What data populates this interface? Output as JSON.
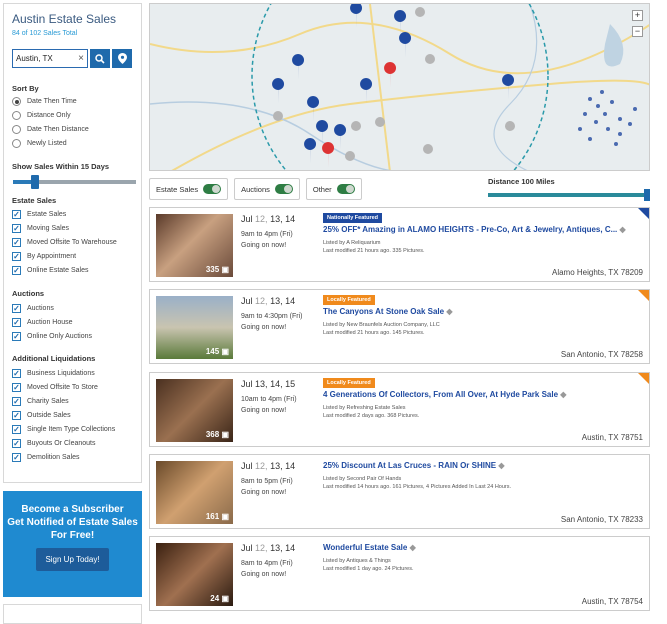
{
  "sidebar": {
    "title": "Austin Estate Sales",
    "count": "84 of 102 Sales Total",
    "search_value": "Austin, TX",
    "sort_heading": "Sort By",
    "sort_options": [
      "Date Then Time",
      "Distance Only",
      "Date Then Distance",
      "Newly Listed"
    ],
    "within_heading": "Show Sales Within 15 Days",
    "estate_heading": "Estate Sales",
    "estate_items": [
      "Estate Sales",
      "Moving Sales",
      "Moved Offsite To Warehouse",
      "By Appointment",
      "Online Estate Sales"
    ],
    "auctions_heading": "Auctions",
    "auction_items": [
      "Auctions",
      "Auction House",
      "Online Only Auctions"
    ],
    "liq_heading": "Additional Liquidations",
    "liq_items": [
      "Business Liquidations",
      "Moved Offsite To Store",
      "Charity Sales",
      "Outside Sales",
      "Single Item Type Collections",
      "Buyouts Or Cleanouts",
      "Demolition Sales"
    ]
  },
  "promo": {
    "line1": "Become a Subscriber",
    "line2": "Get Notified of Estate Sales",
    "line3": "For Free!",
    "button": "Sign Up Today!"
  },
  "toggles": {
    "estate": "Estate Sales",
    "auctions": "Auctions",
    "other": "Other"
  },
  "distance_label": "Distance 100 Miles",
  "listings": [
    {
      "d1": "Jul",
      "d2": "12,",
      "d3": "13,",
      "d4": "14",
      "time": "9am to 4pm (Fri)",
      "status": "Going on now!",
      "badge": "Nationally Featured",
      "title": "25% OFF* Amazing in ALAMO HEIGHTS - Pre-Co, Art & Jewelry, Antiques, C...",
      "by": "Listed by A Reliquarium",
      "mod": "Last modified 21 hours ago. 335 Pictures.",
      "loc": "Alamo Heights, TX 78209",
      "pics": "335"
    },
    {
      "d1": "Jul",
      "d2": "12,",
      "d3": "13,",
      "d4": "14",
      "time": "9am to 4:30pm (Fri)",
      "status": "Going on now!",
      "badge": "Locally Featured",
      "title": "The Canyons At Stone Oak Sale",
      "by": "Listed by New Braunfels Auction Company, LLC",
      "mod": "Last modified 21 hours ago. 145 Pictures.",
      "loc": "San Antonio, TX 78258",
      "pics": "145"
    },
    {
      "d1": "Jul",
      "d2": "13,",
      "d3": "14,",
      "d4": "15",
      "time": "10am to 4pm (Fri)",
      "status": "Going on now!",
      "badge": "Locally Featured",
      "title": "4 Generations Of Collectors, From All Over, At Hyde Park Sale",
      "by": "Listed by Refreshing Estate Sales",
      "mod": "Last modified 2 days ago. 368 Pictures.",
      "loc": "Austin, TX 78751",
      "pics": "368"
    },
    {
      "d1": "Jul",
      "d2": "12,",
      "d3": "13,",
      "d4": "14",
      "time": "8am to 5pm (Fri)",
      "status": "Going on now!",
      "badge": "",
      "title": "25% Discount At Las Cruces - RAIN Or SHINE",
      "by": "Listed by Second Pair Of Hands",
      "mod": "Last modified 14 hours ago. 161 Pictures, 4 Pictures Added In Last 24 Hours.",
      "loc": "San Antonio, TX 78233",
      "pics": "161"
    },
    {
      "d1": "Jul",
      "d2": "12,",
      "d3": "13,",
      "d4": "14",
      "time": "8am to 4pm (Fri)",
      "status": "Going on now!",
      "badge": "",
      "title": "Wonderful Estate Sale",
      "by": "Listed by Antiques & Things",
      "mod": "Last modified 1 day ago. 24 Pictures.",
      "loc": "Austin, TX 78754",
      "pics": "24"
    }
  ],
  "colors": {
    "national": "#1f4aa0",
    "local": "#f08a1c",
    "accent": "#1f6aac"
  }
}
